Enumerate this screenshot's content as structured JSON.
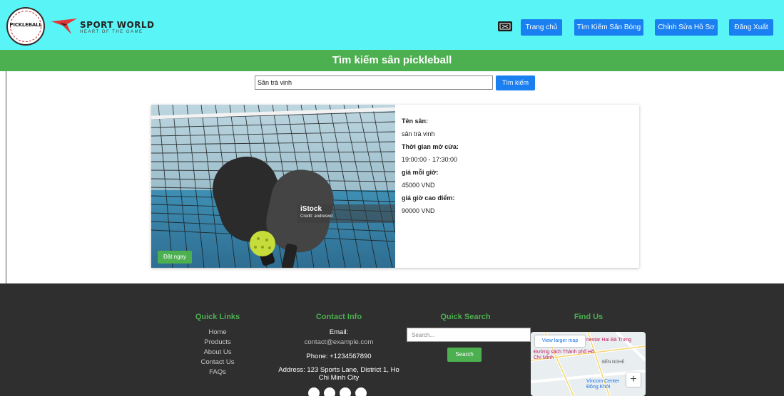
{
  "header": {
    "logo_text": "PICKLEBALL",
    "brand_name": "SPORT WORLD",
    "brand_tagline": "HEART OF THE GAME",
    "nav": [
      {
        "label": "Trang chủ"
      },
      {
        "label": "Tìm Kiếm Sân Bóng"
      },
      {
        "label": "Chỉnh Sửa Hồ Sơ"
      },
      {
        "label": "Đăng Xuất"
      }
    ],
    "icon": "ticket-icon"
  },
  "page": {
    "title": "Tìm kiếm sân pickleball"
  },
  "search": {
    "value": "Sân trà vinh",
    "button_label": "Tìm kiếm"
  },
  "card": {
    "image_watermark": "iStock",
    "image_credit": "Credit: andreswd",
    "book_label": "Đặt ngay",
    "name_label": "Tên sân:",
    "name_value": "sân trà vinh",
    "hours_label": "Thời gian mở cửa:",
    "hours_value": "19:00:00 - 17:30:00",
    "price_label": "giá mỗi giờ:",
    "price_value": "45000 VND",
    "peak_label": "giá giờ cao điểm:",
    "peak_value": "90000 VND"
  },
  "footer": {
    "quick_links_title": "Quick Links",
    "quick_links": [
      "Home",
      "Products",
      "About Us",
      "Contact Us",
      "FAQs"
    ],
    "contact_title": "Contact Info",
    "email_label": "Email:",
    "email_value": "contact@example.com",
    "phone": "Phone: +1234567890",
    "address": "Address: 123 Sports Lane, District 1, Ho Chi Minh City",
    "quick_search_title": "Quick Search",
    "quick_search_placeholder": "Search...",
    "quick_search_button": "Search",
    "find_us_title": "Find Us",
    "map_link": "View larger map",
    "map_labels": [
      "Đường sách Thành phố Hồ Chí Minh",
      "Vincom Center Đồng Khởi",
      "BẾN NGHÉ",
      "nestar Hai Bà Trưng"
    ],
    "social_icons": [
      "facebook-icon",
      "twitter-icon",
      "instagram-icon",
      "linkedin-icon"
    ]
  },
  "colors": {
    "header_bg": "#59f5f6",
    "accent_green": "#4caf50",
    "nav_blue": "#1a7ff0",
    "footer_bg": "#2f2f2f"
  }
}
